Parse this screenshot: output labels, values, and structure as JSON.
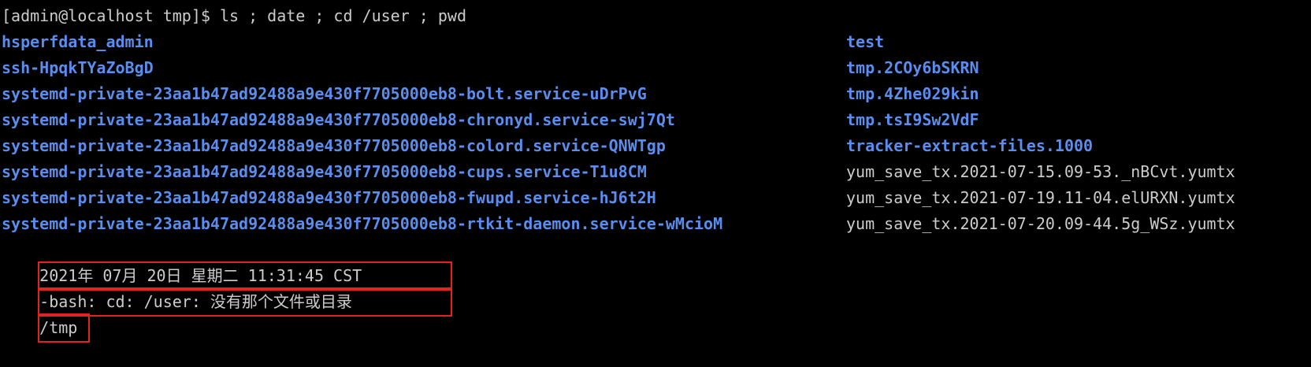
{
  "terminal": {
    "prompt_line": "[admin@localhost tmp]$ ls ; date ; cd /user ; pwd",
    "colors": {
      "background": "#000000",
      "text": "#cccccc",
      "directory": "#5b8def",
      "highlight_box": "#e02424"
    },
    "ls_rows": [
      {
        "left": "hsperfdata_admin",
        "left_dir": true,
        "right": "test",
        "right_dir": true
      },
      {
        "left": "ssh-HpqkTYaZoBgD",
        "left_dir": true,
        "right": "tmp.2COy6bSKRN",
        "right_dir": true
      },
      {
        "left": "systemd-private-23aa1b47ad92488a9e430f7705000eb8-bolt.service-uDrPvG",
        "left_dir": true,
        "right": "tmp.4Zhe029kin",
        "right_dir": true
      },
      {
        "left": "systemd-private-23aa1b47ad92488a9e430f7705000eb8-chronyd.service-swj7Qt",
        "left_dir": true,
        "right": "tmp.tsI9Sw2VdF",
        "right_dir": true
      },
      {
        "left": "systemd-private-23aa1b47ad92488a9e430f7705000eb8-colord.service-QNWTgp",
        "left_dir": true,
        "right": "tracker-extract-files.1000",
        "right_dir": true
      },
      {
        "left": "systemd-private-23aa1b47ad92488a9e430f7705000eb8-cups.service-T1u8CM",
        "left_dir": true,
        "right": "yum_save_tx.2021-07-15.09-53._nBCvt.yumtx",
        "right_dir": false
      },
      {
        "left": "systemd-private-23aa1b47ad92488a9e430f7705000eb8-fwupd.service-hJ6t2H",
        "left_dir": true,
        "right": "yum_save_tx.2021-07-19.11-04.elURXN.yumtx",
        "right_dir": false
      },
      {
        "left": "systemd-private-23aa1b47ad92488a9e430f7705000eb8-rtkit-daemon.service-wMcioM",
        "left_dir": true,
        "right": "yum_save_tx.2021-07-20.09-44.5g_WSz.yumtx",
        "right_dir": false
      }
    ],
    "date_output": "2021年 07月 20日 星期二 11:31:45 CST",
    "cd_error": "-bash: cd: /user: 没有那个文件或目录",
    "pwd_output": "/tmp"
  }
}
